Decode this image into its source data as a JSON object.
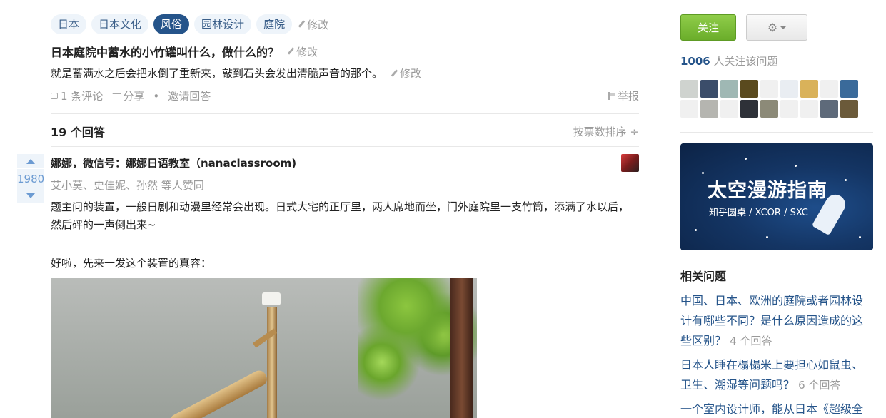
{
  "tags": [
    "日本",
    "日本文化",
    "风俗",
    "园林设计",
    "庭院"
  ],
  "active_tag_index": 2,
  "edit_label": "修改",
  "question": {
    "title": "日本庭院中蓄水的小竹罐叫什么，做什么的？",
    "detail": "就是蓄满水之后会把水倒了重新来，敲到石头会发出清脆声音的那个。",
    "comments": "1 条评论",
    "share": "分享",
    "dot": "•",
    "invite": "邀请回答",
    "report": "举报"
  },
  "answers": {
    "count_label": "19 个回答",
    "sort_label": "按票数排序 ÷"
  },
  "answer": {
    "votes": "1980",
    "author": "娜娜，微信号：娜娜日语教室（nanaclassroom)",
    "voters": "艾小莫、史佳妮、孙然 等人赞同",
    "text1": "题主问的装置，一般日剧和动漫里经常会出现。日式大宅的正厅里，两人席地而坐，门外庭院里一支竹筒，添满了水以后，然后砰的一声倒出来~",
    "text2": "好啦，先来一发这个装置的真容："
  },
  "sidebar": {
    "follow_label": "关注",
    "followers_count": "1006",
    "followers_suffix": " 人关注该问题",
    "banner_title": "太空漫游指南",
    "banner_sub": "知乎圆桌 / XCOR / SXC",
    "related_title": "相关问题",
    "related": [
      {
        "text": "中国、日本、欧洲的庭院或者园林设计有哪些不同？是什么原因造成的这些区别？",
        "count": "4 个回答"
      },
      {
        "text": "日本人睡在榻榻米上要担心如鼠虫、卫生、潮湿等问题吗？",
        "count": "6 个回答"
      },
      {
        "text": "一个室内设计师，能从日本《超级全",
        "count": ""
      }
    ]
  },
  "colors": {
    "link": "#25548a",
    "muted": "#999999",
    "follow_green": "#7bbd36",
    "tag_bg": "#eef4fa"
  },
  "avatar_colors": [
    "#cfd3cf",
    "#3b4d6a",
    "#9fb8b4",
    "#5a4a1e",
    "#f0f0f0",
    "#e9edf2",
    "#d9b25a",
    "#f0f0f0",
    "#3a6a9a",
    "#f0f0f0",
    "#b5b5b0",
    "#f0f0f0",
    "#2e3138",
    "#8c8a78",
    "#f0f0f0",
    "#f0f0f0",
    "#5e6a7a",
    "#6b5a3a"
  ]
}
